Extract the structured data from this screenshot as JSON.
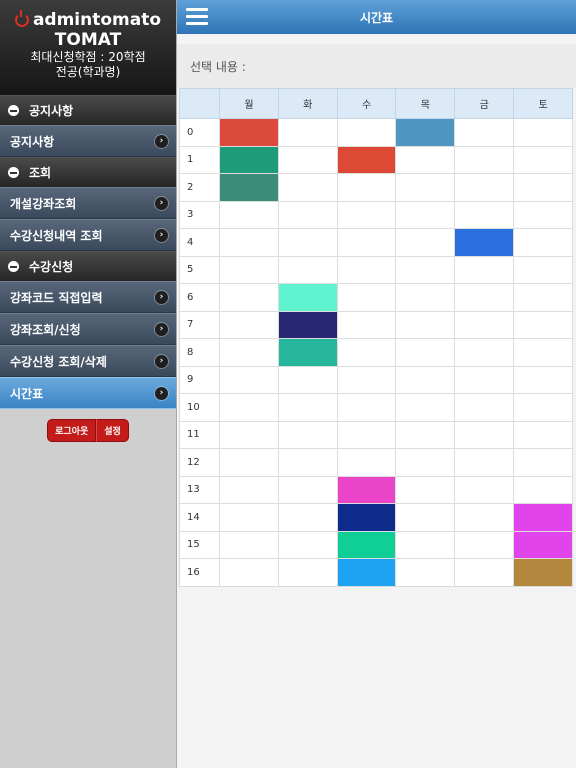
{
  "app": {
    "brand": "admintomato",
    "student_name": "TOMAT",
    "max_credits": "최대신청학점 : 20학점",
    "major": "전공(학과명)"
  },
  "sidebar": {
    "sections": [
      {
        "title": "공지사항",
        "items": [
          {
            "label": "공지사항",
            "active": false
          }
        ]
      },
      {
        "title": "조회",
        "items": [
          {
            "label": "개설강좌조회",
            "active": false
          },
          {
            "label": "수강신청내역 조회",
            "active": false
          }
        ]
      },
      {
        "title": "수강신청",
        "items": [
          {
            "label": "강좌코드 직접입력",
            "active": false
          },
          {
            "label": "강좌조회/신청",
            "active": false
          },
          {
            "label": "수강신청 조회/삭제",
            "active": false
          },
          {
            "label": "시간표",
            "active": true
          }
        ]
      }
    ],
    "buttons": {
      "logout": "로그아웃",
      "settings": "설정"
    }
  },
  "header": {
    "title": "시간표"
  },
  "selection": {
    "label": "선택 내용 :",
    "value": ""
  },
  "timetable": {
    "days": [
      "월",
      "화",
      "수",
      "목",
      "금",
      "토"
    ],
    "periods": [
      "0",
      "1",
      "2",
      "3",
      "4",
      "5",
      "6",
      "7",
      "8",
      "9",
      "10",
      "11",
      "12",
      "13",
      "14",
      "15",
      "16"
    ],
    "colors": {
      "0": [
        "#db4a3a",
        null,
        null,
        "#4f96c0",
        null,
        null
      ],
      "1": [
        "#1e9c79",
        null,
        "#dc4a36",
        null,
        null,
        null
      ],
      "2": [
        "#3c8c7a",
        null,
        null,
        null,
        null,
        null
      ],
      "4": [
        null,
        null,
        null,
        null,
        "#2b6fdf",
        null
      ],
      "6": [
        null,
        "#5ef2cf",
        null,
        null,
        null,
        null
      ],
      "7": [
        null,
        "#272671",
        null,
        null,
        null,
        null
      ],
      "8": [
        null,
        "#26b69b",
        null,
        null,
        null,
        null
      ],
      "13": [
        null,
        null,
        "#ea44c8",
        null,
        null,
        null
      ],
      "14": [
        null,
        null,
        "#0d2c8b",
        null,
        null,
        "#e244ec"
      ],
      "15": [
        null,
        null,
        "#0fcf96",
        null,
        null,
        "#e244ec"
      ],
      "16": [
        null,
        null,
        "#1ea3f2",
        null,
        null,
        "#b3883e"
      ]
    }
  }
}
